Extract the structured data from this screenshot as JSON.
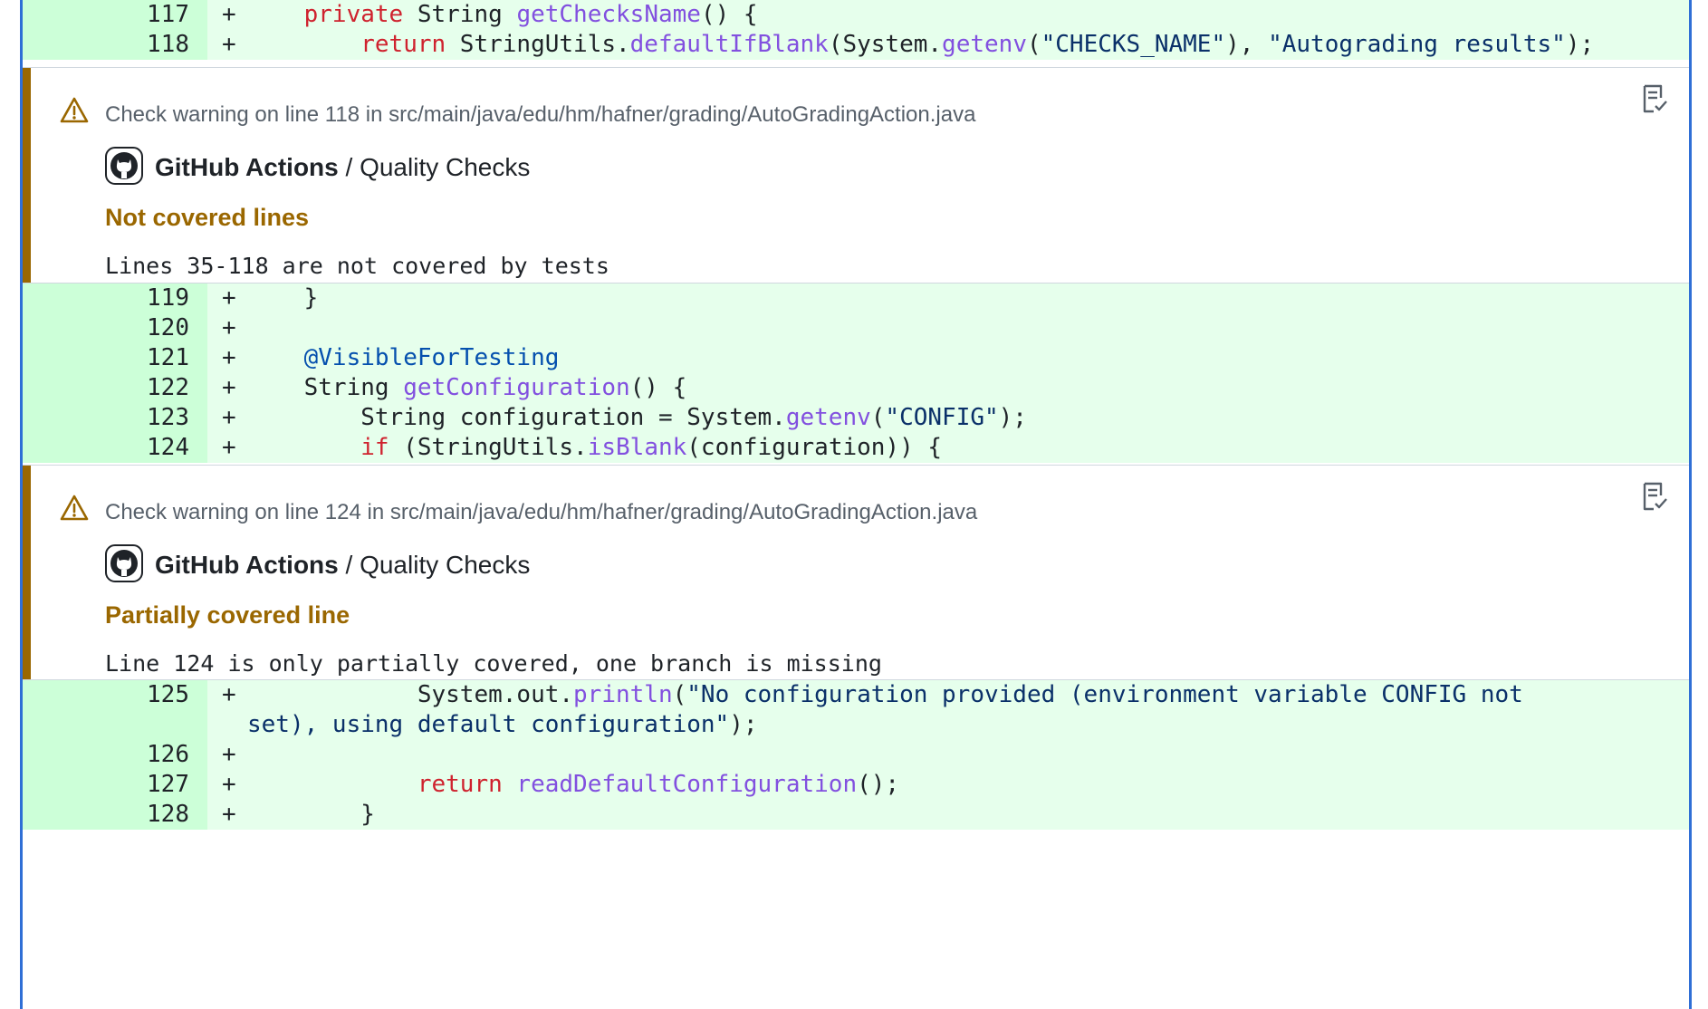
{
  "diff": {
    "rows_top": [
      {
        "line": "117",
        "marker": "+",
        "tokens": [
          {
            "t": "    "
          },
          {
            "t": "private",
            "c": "kw"
          },
          {
            "t": " String "
          },
          {
            "t": "getChecksName",
            "c": "fn"
          },
          {
            "t": "() {"
          }
        ]
      },
      {
        "line": "118",
        "marker": "+",
        "tokens": [
          {
            "t": "        "
          },
          {
            "t": "return",
            "c": "kw"
          },
          {
            "t": " StringUtils."
          },
          {
            "t": "defaultIfBlank",
            "c": "fn"
          },
          {
            "t": "(System."
          },
          {
            "t": "getenv",
            "c": "fn"
          },
          {
            "t": "("
          },
          {
            "t": "\"CHECKS_NAME\"",
            "c": "st"
          },
          {
            "t": "), "
          },
          {
            "t": "\"Autograding results\"",
            "c": "st"
          },
          {
            "t": ");"
          }
        ]
      }
    ],
    "rows_middle": [
      {
        "line": "119",
        "marker": "+",
        "tokens": [
          {
            "t": "    }"
          }
        ]
      },
      {
        "line": "120",
        "marker": "+",
        "tokens": []
      },
      {
        "line": "121",
        "marker": "+",
        "tokens": [
          {
            "t": "    "
          },
          {
            "t": "@VisibleForTesting",
            "c": "an"
          }
        ]
      },
      {
        "line": "122",
        "marker": "+",
        "tokens": [
          {
            "t": "    String "
          },
          {
            "t": "getConfiguration",
            "c": "fn"
          },
          {
            "t": "() {"
          }
        ]
      },
      {
        "line": "123",
        "marker": "+",
        "tokens": [
          {
            "t": "        String configuration = System."
          },
          {
            "t": "getenv",
            "c": "fn"
          },
          {
            "t": "("
          },
          {
            "t": "\"CONFIG\"",
            "c": "st"
          },
          {
            "t": ");"
          }
        ]
      },
      {
        "line": "124",
        "marker": "+",
        "tokens": [
          {
            "t": "        "
          },
          {
            "t": "if",
            "c": "kw"
          },
          {
            "t": " (StringUtils."
          },
          {
            "t": "isBlank",
            "c": "fn"
          },
          {
            "t": "(configuration)) {"
          }
        ]
      }
    ],
    "rows_bottom": [
      {
        "line": "125",
        "marker": "+",
        "tokens": [
          {
            "t": "            System.out."
          },
          {
            "t": "println",
            "c": "fn"
          },
          {
            "t": "("
          },
          {
            "t": "\"No configuration provided (environment variable CONFIG not set), using default configuration\"",
            "c": "st"
          },
          {
            "t": ");"
          }
        ]
      },
      {
        "line": "126",
        "marker": "+",
        "tokens": []
      },
      {
        "line": "127",
        "marker": "+",
        "tokens": [
          {
            "t": "            "
          },
          {
            "t": "return",
            "c": "kw"
          },
          {
            "t": " "
          },
          {
            "t": "readDefaultConfiguration",
            "c": "fn"
          },
          {
            "t": "();"
          }
        ]
      },
      {
        "line": "128",
        "marker": "+",
        "tokens": [
          {
            "t": "        }"
          }
        ]
      }
    ]
  },
  "annotations": [
    {
      "header": "Check warning on line 118 in src/main/java/edu/hm/hafner/grading/AutoGradingAction.java",
      "app": "GitHub Actions",
      "separator": " / ",
      "check": "Quality Checks",
      "title": "Not covered lines",
      "message": "Lines 35-118 are not covered by tests"
    },
    {
      "header": "Check warning on line 124 in src/main/java/edu/hm/hafner/grading/AutoGradingAction.java",
      "app": "GitHub Actions",
      "separator": " / ",
      "check": "Quality Checks",
      "title": "Partially covered line",
      "message": "Line 124 is only partially covered, one branch is missing"
    }
  ],
  "icons": {
    "warning": "alert-icon",
    "logo": "github-logo-icon",
    "copy": "copy-annotation-icon"
  },
  "colors": {
    "added_row": "#e6ffec",
    "added_line_number": "#ccffd8",
    "warning_accent": "#9a6700",
    "frame": "#2f6fd6"
  }
}
